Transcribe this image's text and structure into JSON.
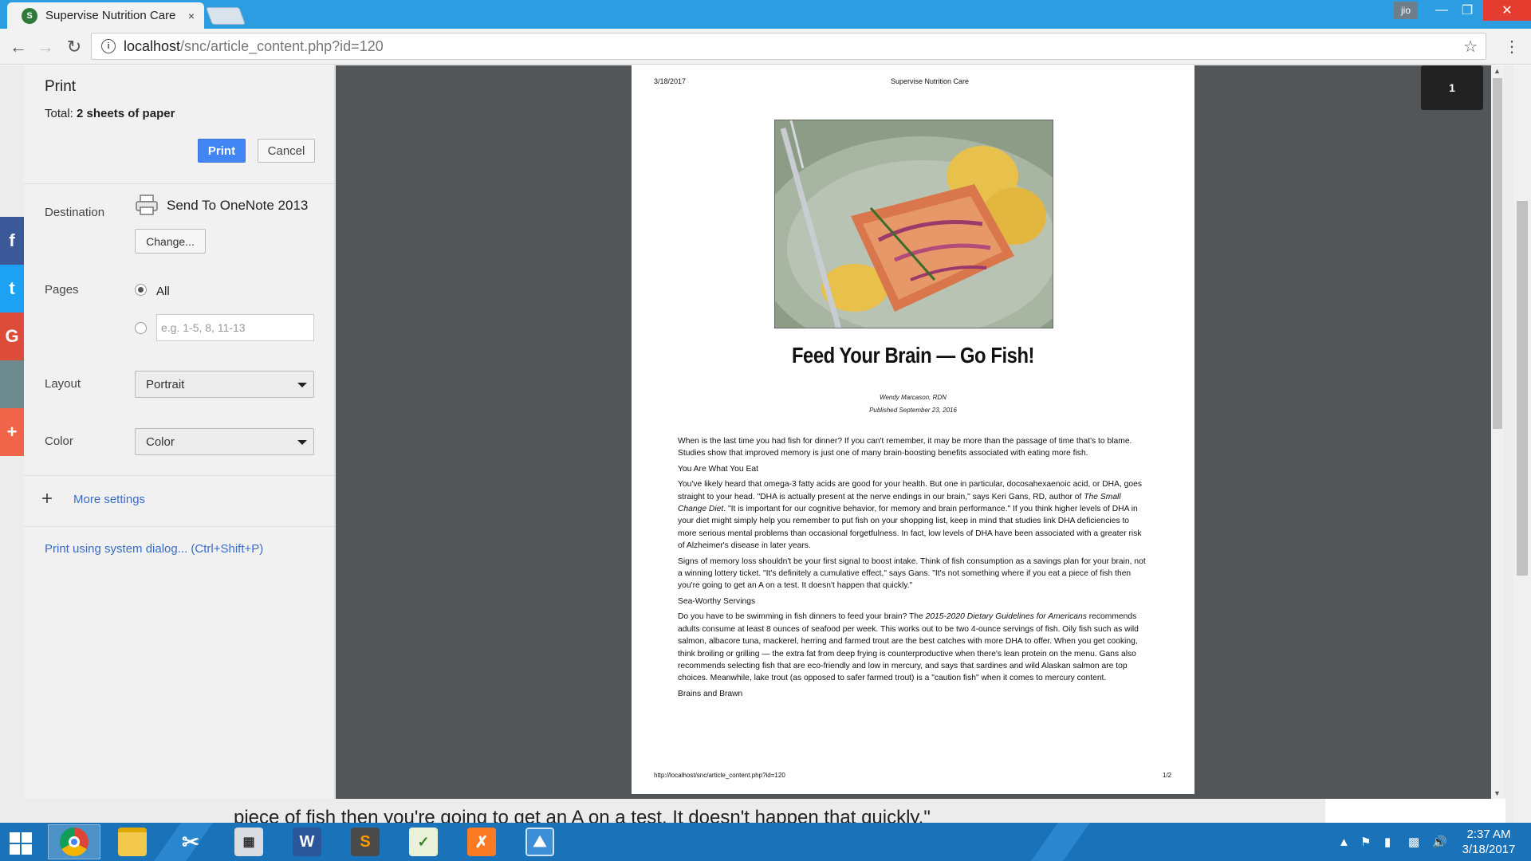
{
  "browser": {
    "tab_title": "Supervise Nutrition Care",
    "tab_close": "×",
    "profile": "jio",
    "url_host": "localhost",
    "url_path": "/snc/article_content.php?id=120"
  },
  "background_page": {
    "snippet": "piece of fish then you're going to get an A on a test. It doesn't happen that quickly.\"",
    "social": [
      "f",
      "t",
      "G",
      "",
      "+"
    ]
  },
  "print_panel": {
    "title": "Print",
    "total_label": "Total:",
    "total_value": "2 sheets of paper",
    "print_button": "Print",
    "cancel_button": "Cancel",
    "destination_label": "Destination",
    "destination_value": "Send To OneNote 2013",
    "change_button": "Change...",
    "pages_label": "Pages",
    "pages_all": "All",
    "pages_placeholder": "e.g. 1-5, 8, 11-13",
    "layout_label": "Layout",
    "layout_value": "Portrait",
    "color_label": "Color",
    "color_value": "Color",
    "more_settings": "More settings",
    "system_dialog": "Print using system dialog... (Ctrl+Shift+P)"
  },
  "preview": {
    "page_badge": "1",
    "header_date": "3/18/2017",
    "header_site": "Supervise Nutrition Care",
    "title": "Feed Your Brain — Go Fish!",
    "author": "Wendy Marcason, RDN",
    "published": "Published September 23, 2016",
    "para1": "When is the last time you had fish for dinner? If you can't remember, it may be more than the passage of time that's to blame. Studies show that improved memory is just one of many brain-boosting benefits associated with eating more fish.",
    "sub1": "You Are What You Eat",
    "para2a": "You've likely heard that omega-3 fatty acids are good for your health. But one in particular, docosahexaenoic acid, or DHA, goes straight to your head. \"DHA is actually present at the nerve endings in our brain,\" says Keri Gans, RD, author of ",
    "para2_book": "The Small Change Diet",
    "para2b": ". \"It is important for our cognitive behavior, for memory and brain performance.\" If you think higher levels of DHA in your diet might simply help you remember to put fish on your shopping list, keep in mind that studies link DHA deficiencies to more serious mental problems than occasional forgetfulness. In fact, low levels of DHA have been associated with a greater risk of Alzheimer's disease in later years.",
    "para3": "Signs of memory loss shouldn't be your first signal to boost intake. Think of fish consumption as a savings plan for your brain, not a winning lottery ticket. \"It's definitely a cumulative effect,\" says Gans. \"It's not something where if you eat a piece of fish then you're going to get an A on a test. It doesn't happen that quickly.\"",
    "sub2": "Sea-Worthy Servings",
    "para4a": "Do you have to be swimming in fish dinners to feed your brain? The ",
    "para4_guide": "2015-2020 Dietary Guidelines for Americans",
    "para4b": " recommends adults consume at least 8 ounces of seafood per week. This works out to be two 4-ounce servings of fish. Oily fish such as wild salmon, albacore tuna, mackerel, herring and farmed trout are the best catches with more DHA to offer. When you get cooking, think broiling or grilling — the extra fat from deep frying is counterproductive when there's lean protein on the menu. Gans also recommends selecting fish that are eco-friendly and low in mercury, and says that sardines and wild Alaskan salmon are top choices. Meanwhile, lake trout (as opposed to safer farmed trout) is a \"caution fish\" when it comes to mercury content.",
    "sub3": "Brains and Brawn",
    "footer_url": "http://localhost/snc/article_content.php?id=120",
    "footer_page": "1/2"
  },
  "taskbar": {
    "apps": [
      "chrome-icon",
      "file-explorer-icon",
      "snipping-tool-icon",
      "calculator-icon",
      "word-icon",
      "sublime-text-icon",
      "notepad-icon",
      "xampp-icon",
      "photos-icon"
    ],
    "time": "2:37 AM",
    "date": "3/18/2017"
  }
}
